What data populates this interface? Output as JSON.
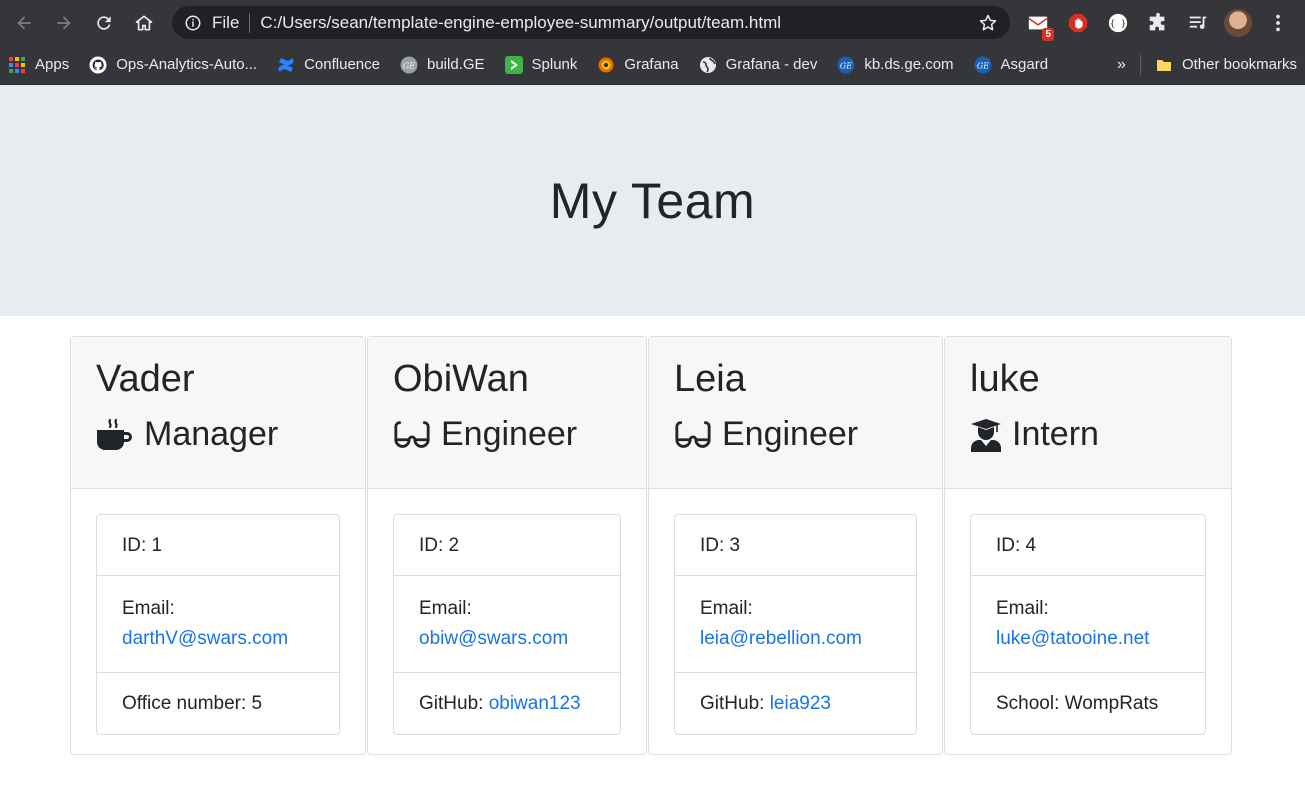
{
  "browser": {
    "scheme": "File",
    "url": "C:/Users/sean/template-engine-employee-summary/output/team.html",
    "mail_badge": "5",
    "bookmarks": [
      {
        "label": "Apps",
        "icon": "apps-grid-icon",
        "color": "#ea4335"
      },
      {
        "label": "Ops-Analytics-Auto...",
        "icon": "github-icon",
        "color": "#ffffff"
      },
      {
        "label": "Confluence",
        "icon": "confluence-icon",
        "color": "#2684ff"
      },
      {
        "label": "build.GE",
        "icon": "ge-icon",
        "color": "#9aa0a6"
      },
      {
        "label": "Splunk",
        "icon": "splunk-icon",
        "color": "#3fb24a"
      },
      {
        "label": "Grafana",
        "icon": "grafana-icon",
        "color": "#f46800"
      },
      {
        "label": "Grafana - dev",
        "icon": "globe-icon",
        "color": "#e8eaed"
      },
      {
        "label": "kb.ds.ge.com",
        "icon": "ge-icon",
        "color": "#1a5fb4"
      },
      {
        "label": "Asgard",
        "icon": "ge-icon",
        "color": "#1a5fb4"
      }
    ],
    "more": "»",
    "other_bookmarks": "Other bookmarks"
  },
  "page": {
    "title": "My Team"
  },
  "team": [
    {
      "name": "Vader",
      "role": "Manager",
      "role_icon": "coffee-mug-icon",
      "id_label": "ID: 1",
      "email_label": "Email:",
      "email": "darthV@swars.com",
      "extra_label": "Office number: 5",
      "extra_link": ""
    },
    {
      "name": "ObiWan",
      "role": "Engineer",
      "role_icon": "glasses-icon",
      "id_label": "ID: 2",
      "email_label": "Email:",
      "email": "obiw@swars.com",
      "extra_label": "GitHub: ",
      "extra_link": "obiwan123"
    },
    {
      "name": "Leia",
      "role": "Engineer",
      "role_icon": "glasses-icon",
      "id_label": "ID: 3",
      "email_label": "Email:",
      "email": "leia@rebellion.com",
      "extra_label": "GitHub: ",
      "extra_link": "leia923"
    },
    {
      "name": "luke",
      "role": "Intern",
      "role_icon": "graduate-icon",
      "id_label": "ID: 4",
      "email_label": "Email:",
      "email": "luke@tatooine.net",
      "extra_label": "School: WompRats",
      "extra_link": ""
    }
  ],
  "colors": {
    "link": "#1a73e8",
    "jumbotron": "#e9ecef",
    "card_header": "#f7f7f7",
    "chrome": "#35363a"
  }
}
